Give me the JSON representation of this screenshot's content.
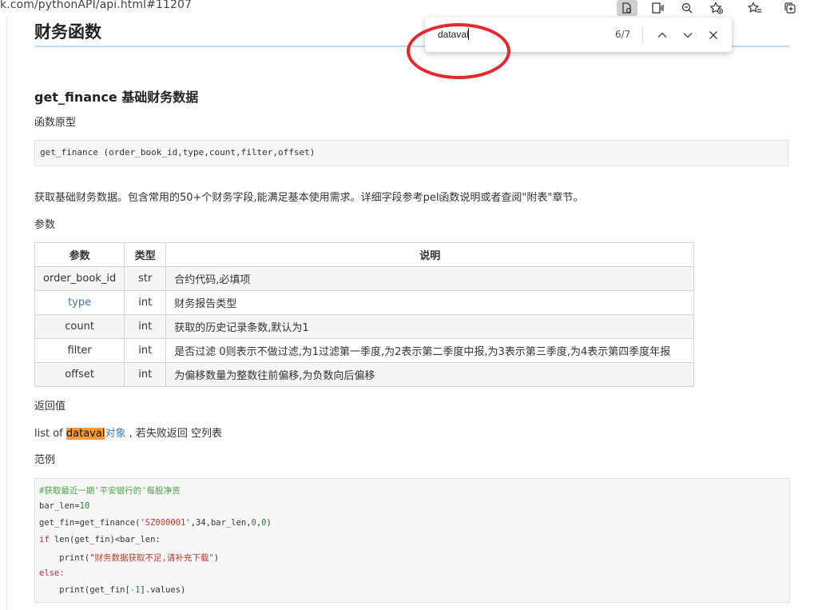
{
  "browser": {
    "url": "k.com/pythonAPI/api.html#11207",
    "icons": [
      "immersive-reader-icon",
      "read-aloud-icon",
      "zoom-icon",
      "favorite-add-icon",
      "favorites-icon",
      "collections-icon"
    ]
  },
  "find": {
    "query": "dataval",
    "count": "6/7",
    "prev_icon": "chevron-up-icon",
    "next_icon": "chevron-down-icon",
    "close_icon": "close-icon"
  },
  "page": {
    "title": "财务函数",
    "func_heading": "get_finance 基础财务数据",
    "prototype_label": "函数原型",
    "prototype_code": "get_finance (order_book_id,type,count,filter,offset)",
    "description": "获取基础财务数据。包含常用的50+个财务字段,能满足基本使用需求。详细字段参考pel函数说明或者查阅\"附表\"章节。",
    "params_label": "参数",
    "params_table": {
      "headers": [
        "参数",
        "类型",
        "说明"
      ],
      "rows": [
        [
          "order_book_id",
          "str",
          "合约代码,必填项"
        ],
        [
          "type",
          "int",
          "财务报告类型"
        ],
        [
          "count",
          "int",
          "获取的历史记录条数,默认为1"
        ],
        [
          "filter",
          "int",
          "是否过滤 0则表示不做过滤,为1过滤第一季度,为2表示第二季度中报,为3表示第三季度,为4表示第四季度年报"
        ],
        [
          "offset",
          "int",
          "为偏移数量为整数往前偏移,为负数向后偏移"
        ]
      ]
    },
    "return_label": "返回值",
    "return_prefix": "list of ",
    "return_highlight": "dataval",
    "return_link": "对象",
    "return_suffix": " , 若失败返回 空列表",
    "example_label": "范例",
    "example_lines": {
      "l1": "#获取最近一期'平安银行的'每股净资",
      "l2a": "bar_len=",
      "l2b": "10",
      "l3a": "get_fin=get_finance(",
      "l3b": "'SZ000001'",
      "l3c": ",34,bar_len,",
      "l3d": "0",
      "l3e": ",",
      "l3f": "0",
      "l3g": ")",
      "l4a": "if",
      "l4b": " len(get_fin)<bar_len:",
      "l5a": "    print(",
      "l5b": "\"财务数据获取不足,请补充下载\"",
      "l5c": ")",
      "l6": "else:",
      "l7a": "    print(get_fin[",
      "l7b": "-1",
      "l7c": "].values)"
    }
  },
  "annotation": {
    "color": "#e8262b"
  }
}
